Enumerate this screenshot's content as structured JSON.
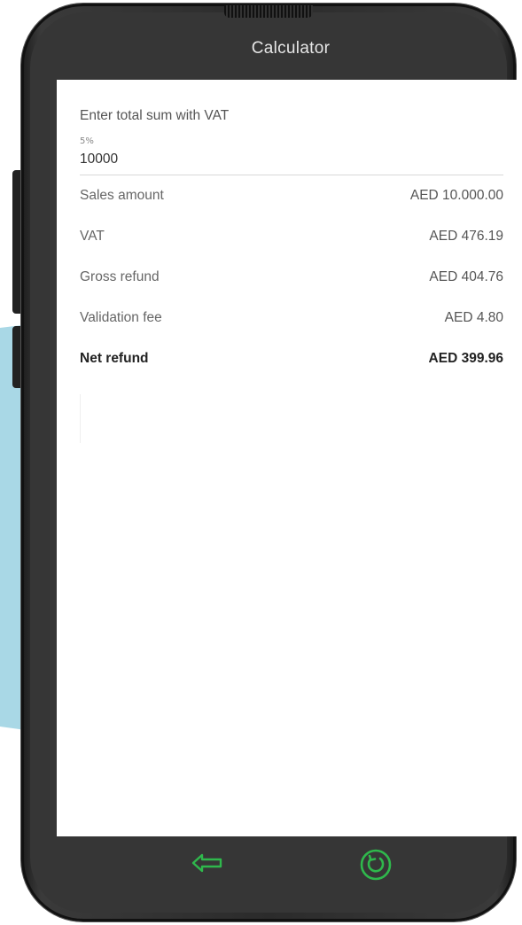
{
  "app": {
    "title": "Calculator"
  },
  "form": {
    "input_label": "Enter total sum with VAT",
    "vat_rate": "5%",
    "input_value": "10000"
  },
  "results": [
    {
      "label": "Sales amount",
      "value": "AED 10.000.00"
    },
    {
      "label": "VAT",
      "value": "AED 476.19"
    },
    {
      "label": "Gross refund",
      "value": "AED 404.76"
    },
    {
      "label": "Validation fee",
      "value": "AED 4.80"
    },
    {
      "label": "Net refund",
      "value": "AED 399.96"
    }
  ],
  "icons": {
    "back": "back-arrow-icon",
    "reset": "reset-icon"
  },
  "colors": {
    "accent": "#2fb84c",
    "background_shape": "#a9d8e6",
    "device_body": "#363636"
  }
}
